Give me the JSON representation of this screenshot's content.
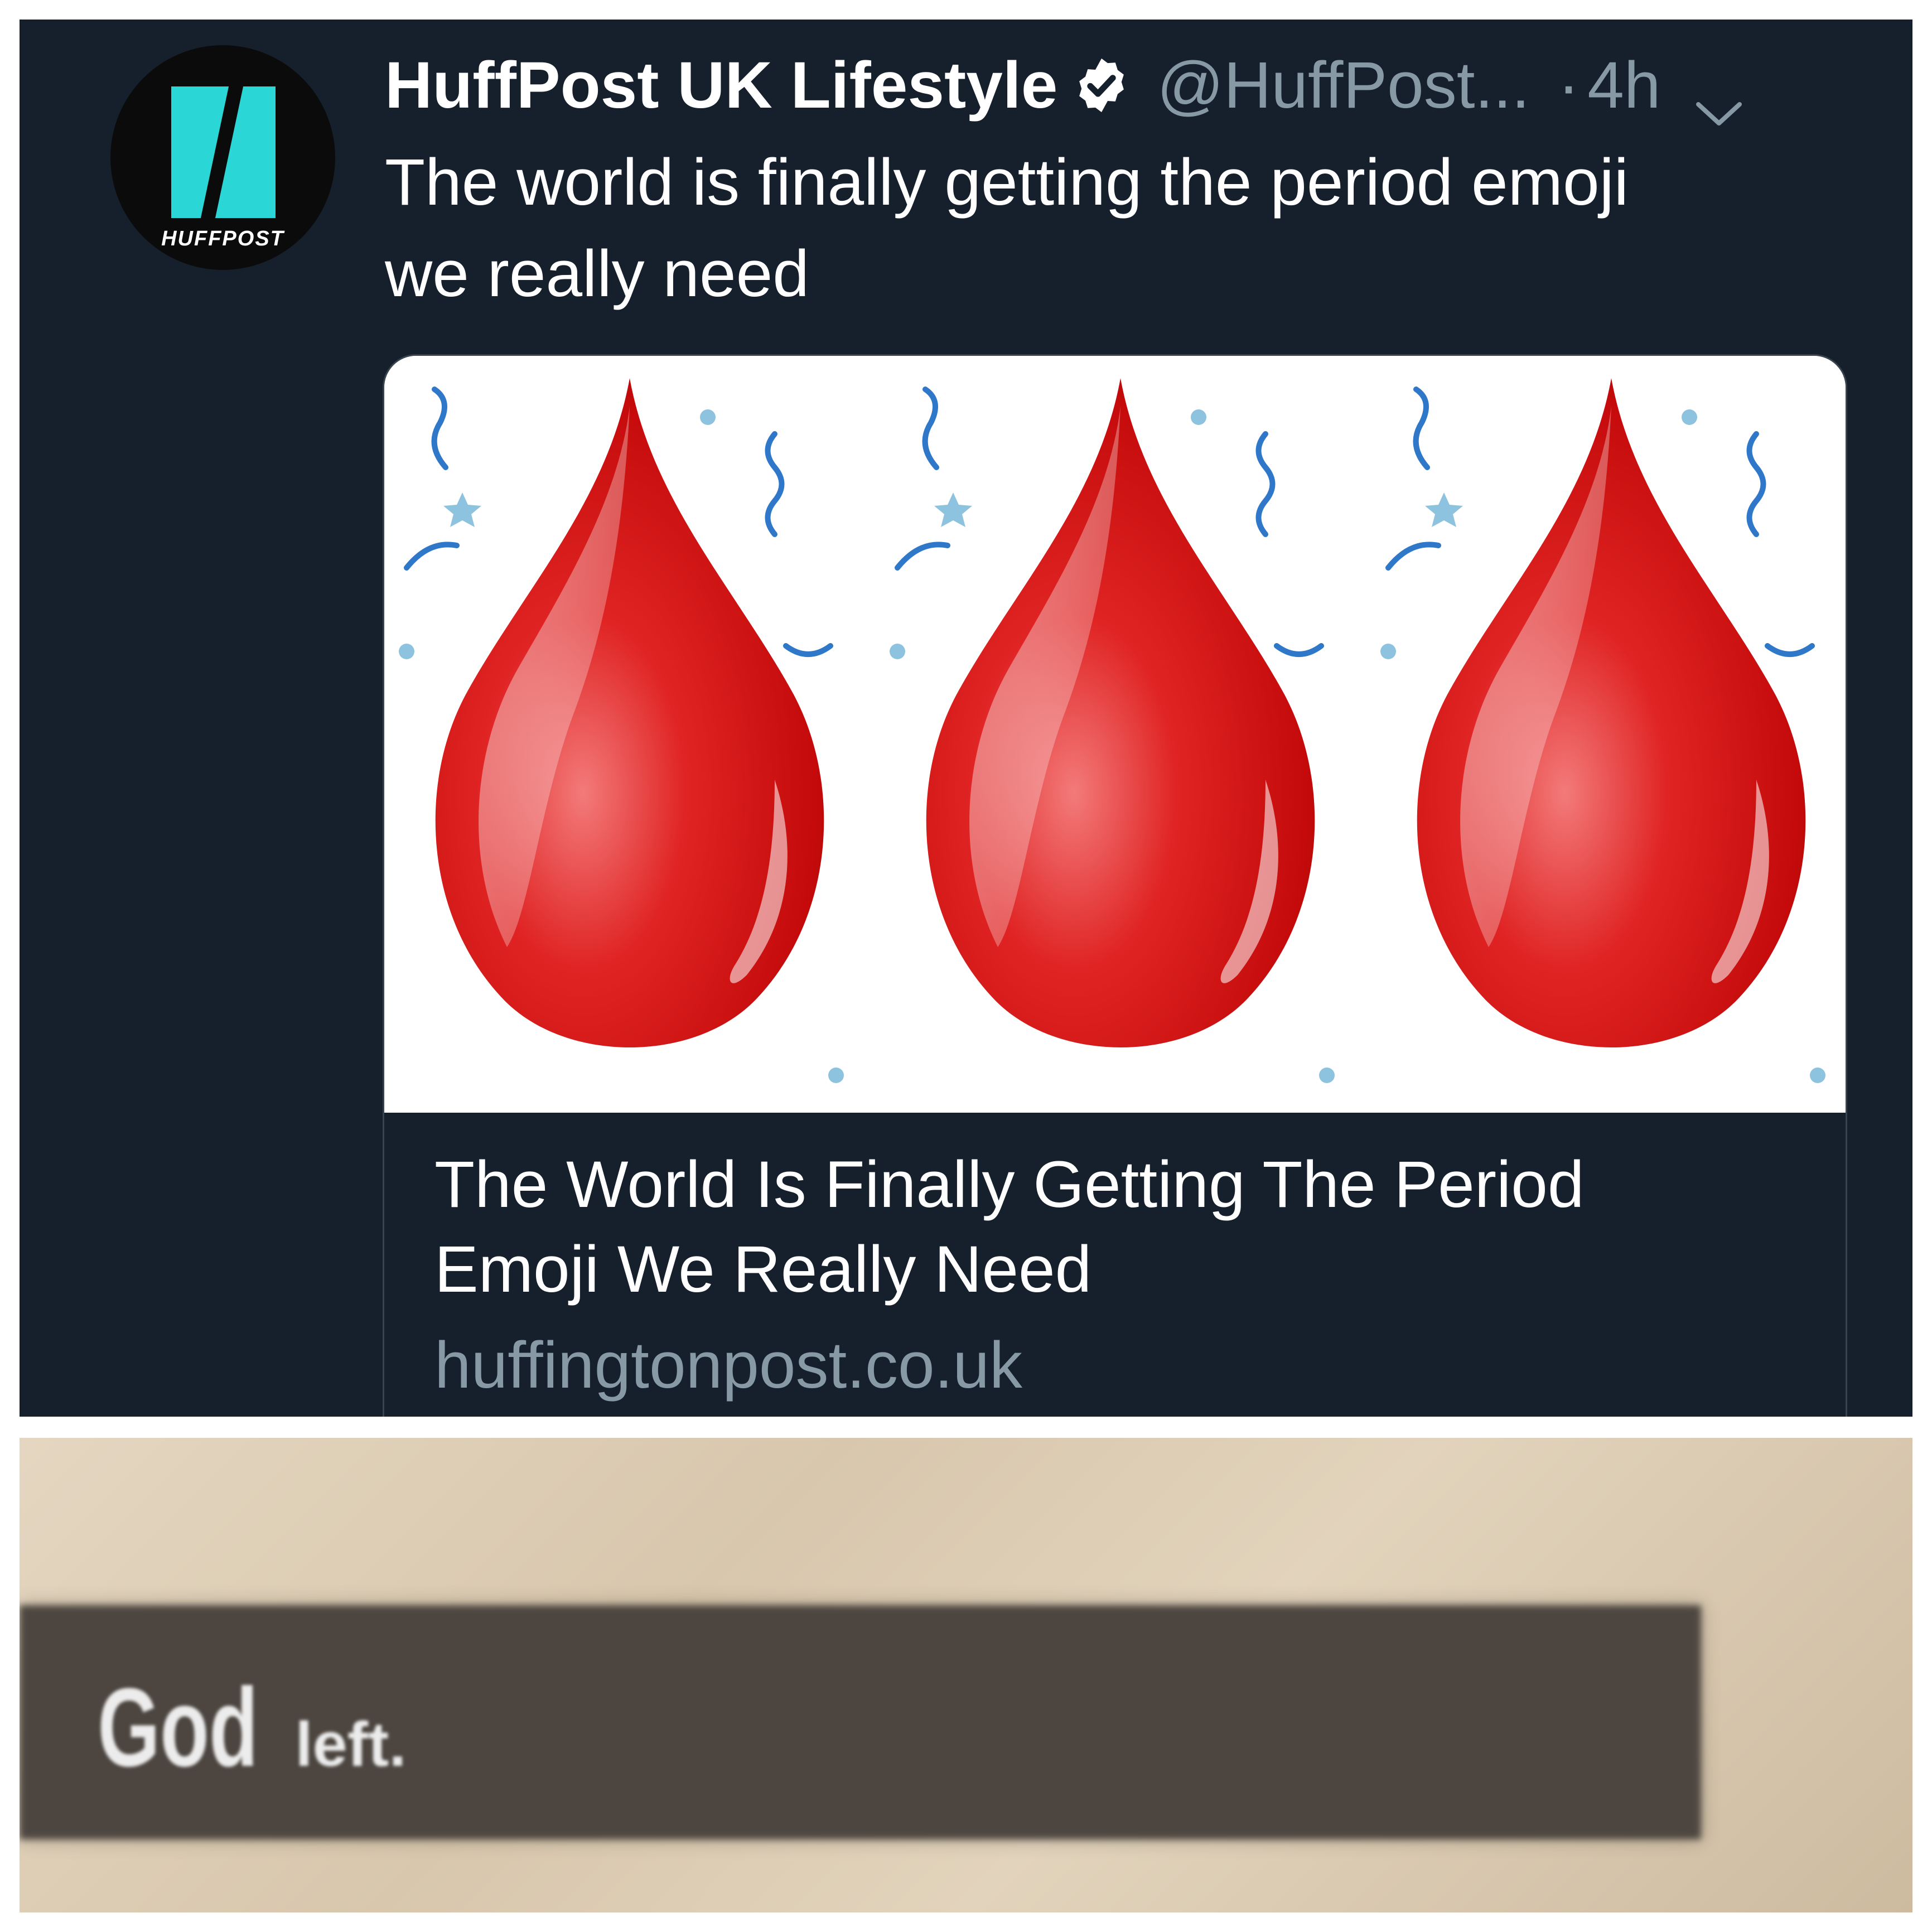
{
  "tweet": {
    "avatar_text": "HUFFPOST",
    "display_name": "HuffPost UK Lifestyle",
    "verified_icon": "verified-badge-icon",
    "handle": "@HuffPost...",
    "separator": "·",
    "timestamp": "4h",
    "menu_icon": "chevron-down-icon",
    "text_line1": "The world is finally getting the period emoji",
    "text_line2": "we really need",
    "card": {
      "image_icons": [
        "blood-drop-icon",
        "blood-drop-icon",
        "blood-drop-icon",
        "confetti-icon"
      ],
      "title_line1": "The World Is Finally Getting The Period",
      "title_line2": "Emoji We Really Need",
      "domain": "huffingtonpost.co.uk"
    }
  },
  "meme": {
    "word1": "God",
    "word2": "left."
  },
  "colors": {
    "tweet_bg": "#16202c",
    "secondary_text": "#8899a6",
    "huffpost_teal": "#2bd6d6",
    "drop_red": "#d20f0f",
    "confetti_blue": "#2f77c8"
  }
}
